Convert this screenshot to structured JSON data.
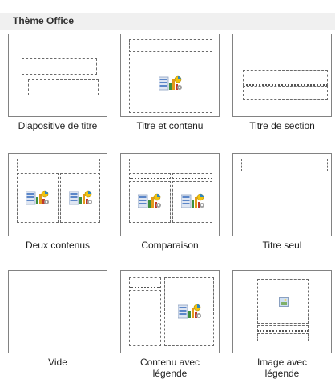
{
  "section": {
    "title": "Thème Office"
  },
  "layouts": [
    {
      "label": "Diapositive de titre"
    },
    {
      "label": "Titre et contenu"
    },
    {
      "label": "Titre de section"
    },
    {
      "label": "Deux contenus"
    },
    {
      "label": "Comparaison"
    },
    {
      "label": "Titre seul"
    },
    {
      "label": "Vide"
    },
    {
      "label": "Contenu avec\nlégende"
    },
    {
      "label": "Image avec\nlégende"
    }
  ],
  "colors": {
    "border": "#828282",
    "header_bg": "#f0f0f0",
    "placeholder": "#6a6a6a"
  }
}
